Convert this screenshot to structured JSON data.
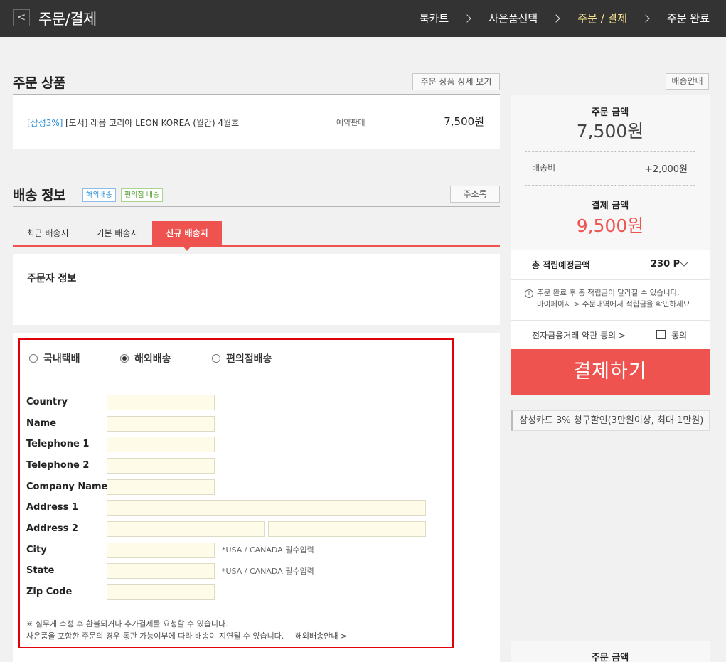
{
  "header": {
    "back_icon": "chevron-left-icon",
    "title": "주문/결제",
    "steps": [
      "북카트",
      "사은품선택",
      "주문 / 결제",
      "주문 완료"
    ],
    "active_step": "주문 / 결제",
    "colors": {
      "bar": "#333333",
      "active_step": "#f5e18d"
    }
  },
  "order_items": {
    "title": "주문 상품",
    "detail_button": "주문 상품 상세 보기",
    "item": {
      "badge": "[삼성3%]",
      "name": "[도서] 레옹 코리아 LEON KOREA (월간) 4월호",
      "status": "예약판매",
      "price": "7,500원"
    }
  },
  "shipping": {
    "title": "배송 정보",
    "tags": [
      "해외배송",
      "편의점 배송"
    ],
    "address_book_button": "주소록",
    "tabs": [
      "최근 배송지",
      "기본 배송지",
      "신규 배송지"
    ],
    "active_tab": "신규 배송지",
    "orderer_title": "주문자 정보",
    "delivery_types": [
      "국내택배",
      "해외배송",
      "편의점배송"
    ],
    "selected_delivery_type": "해외배송",
    "fields": {
      "country": "Country",
      "name": "Name",
      "telephone1": "Telephone 1",
      "telephone2": "Telephone 2",
      "company_name": "Company Name",
      "address1": "Address 1",
      "address2": "Address 2",
      "city": "City",
      "state": "State",
      "zip_code": "Zip Code"
    },
    "required_note": "*USA / CANADA 필수입력",
    "fine_print": [
      "※ 실무게 측정 후 환불되거나 추가결제를 요청할 수 있습니다.",
      "사은품을 포함한 주문의 경우 통관 가능여부에 따라 배송이 지연될 수 있습니다."
    ],
    "overseas_guide_link": "해외배송안내 >"
  },
  "summary": {
    "info_button": "배송안내",
    "order_amount_label": "주문 금액",
    "order_amount": "7,500",
    "currency": "원",
    "shipping_fee_label": "배송비",
    "shipping_fee": "+2,000원",
    "payment_amount_label": "결제 금액",
    "payment_amount": "9,500",
    "points_label": "총 적립예정금액",
    "points_value": "230 P",
    "notice_line1": "주문 완료 후 총 적립금이 달라질 수 있습니다.",
    "notice_line2": "마이페이지 > 주문내역에서 적립금을 확인하세요",
    "terms_label": "전자금융거래 약관 동의 >",
    "agree_label": "동의",
    "pay_button": "결제하기",
    "promo": "삼성카드 3% 청구할인(3만원이상, 최대 1만원)",
    "bottom_order_amount_label": "주문 금액",
    "colors": {
      "accent": "#ef5350",
      "panel": "#f7f7f7"
    }
  }
}
